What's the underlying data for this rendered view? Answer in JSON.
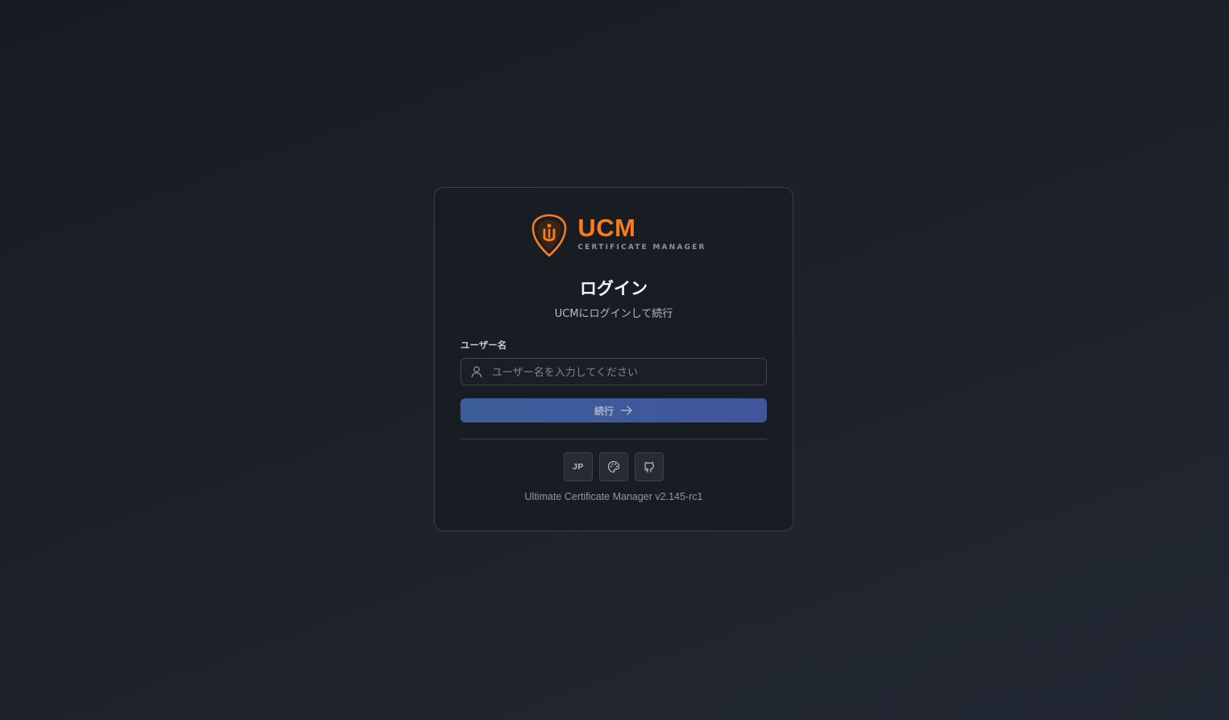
{
  "brand": {
    "name": "UCM",
    "subtitle": "CERTIFICATE MANAGER",
    "logo_icon": "ucm-shield-logo",
    "accent_color": "#f57c1f"
  },
  "login": {
    "title": "ログイン",
    "subtitle": "UCMにログインして続行",
    "username_label": "ユーザー名",
    "username_placeholder": "ユーザー名を入力してください",
    "username_value": "",
    "username_icon": "user-icon",
    "continue_label": "続行",
    "continue_icon": "arrow-right-icon",
    "button_color": "#3b5d9a"
  },
  "footer": {
    "language_label": "JP",
    "theme_icon": "palette-icon",
    "github_icon": "github-icon",
    "version_text": "Ultimate Certificate Manager v2.145-rc1"
  }
}
